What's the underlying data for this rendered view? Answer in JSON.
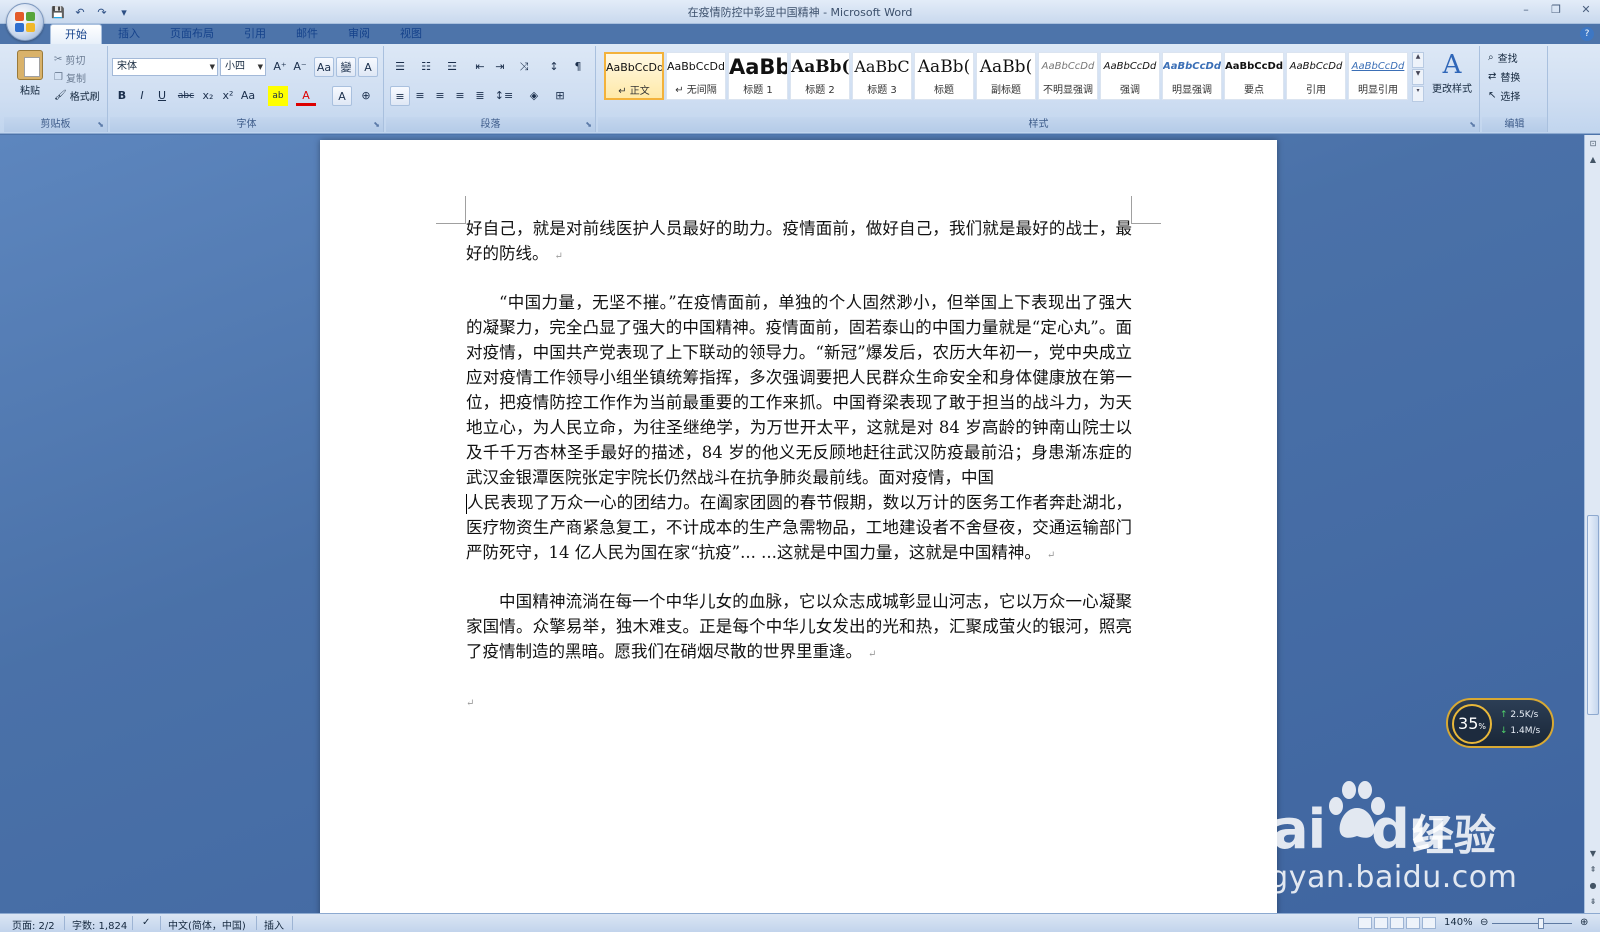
{
  "window": {
    "title": "在疫情防控中彰显中国精神 - Microsoft Word",
    "controls": [
      "–",
      "❐",
      "✕"
    ]
  },
  "qat": [
    "save-icon",
    "undo-icon",
    "redo-icon",
    "customize-icon"
  ],
  "tabs": [
    "开始",
    "插入",
    "页面布局",
    "引用",
    "邮件",
    "审阅",
    "视图"
  ],
  "ribbon": {
    "clipboard": {
      "label": "剪贴板",
      "paste": "粘贴",
      "cut": "剪切",
      "copy": "复制",
      "format_painter": "格式刷"
    },
    "font": {
      "label": "字体",
      "font_name": "宋体",
      "font_size": "小四",
      "buttons_row1": [
        "A⁺",
        "A⁻",
        "Aa",
        "變",
        "A"
      ],
      "buttons_row2": [
        "B",
        "I",
        "U",
        "abc",
        "x₂",
        "x²",
        "Aa",
        "ab",
        "A",
        "A",
        "⊕"
      ]
    },
    "paragraph": {
      "label": "段落",
      "buttons_row1": [
        "☰",
        "☷",
        "☲",
        "⇤",
        "⇥",
        "⤨",
        "↕",
        "¶"
      ],
      "buttons_row2": [
        "≡",
        "≡",
        "≡",
        "≡",
        "≣",
        "↕≡",
        "◈",
        "⊞"
      ]
    },
    "styles": {
      "label": "样式",
      "items": [
        {
          "sample": "AaBbCcDd",
          "name": "↵ 正文",
          "selected": true
        },
        {
          "sample": "AaBbCcDd",
          "name": "↵ 无间隔",
          "selected": false
        },
        {
          "sample": "AaBb",
          "name": "标题 1",
          "selected": false
        },
        {
          "sample": "AaBb(",
          "name": "标题 2",
          "selected": false
        },
        {
          "sample": "AaBbC",
          "name": "标题 3",
          "selected": false
        },
        {
          "sample": "AaBb(",
          "name": "标题",
          "selected": false
        },
        {
          "sample": "AaBb(",
          "name": "副标题",
          "selected": false
        },
        {
          "sample": "AaBbCcDd",
          "name": "不明显强调",
          "selected": false
        },
        {
          "sample": "AaBbCcDd",
          "name": "强调",
          "selected": false
        },
        {
          "sample": "AaBbCcDd",
          "name": "明显强调",
          "selected": false
        },
        {
          "sample": "AaBbCcDd",
          "name": "要点",
          "selected": false
        },
        {
          "sample": "AaBbCcDd",
          "name": "引用",
          "selected": false
        },
        {
          "sample": "AaBbCcDd",
          "name": "明显引用",
          "selected": false
        }
      ],
      "change_styles": "更改样式"
    },
    "editing": {
      "label": "编辑",
      "find": "查找",
      "replace": "替换",
      "select": "选择"
    }
  },
  "document": {
    "paragraphs": [
      {
        "text": "好自己，就是对前线医护人员最好的助力。疫情面前，做好自己，我们就是最好的战士，最好的防线。",
        "indent": false
      },
      {
        "text": "“中国力量，无坚不摧。”在疫情面前，单独的个人固然渺小，但举国上下表现出了强大的凝聚力，完全凸显了强大的中国精神。疫情面前，固若泰山的中国力量就是“定心丸”。面对疫情，中国共产党表现了上下联动的领导力。“新冠”爆发后，农历大年初一，党中央成立应对疫情工作领导小组坐镇统筹指挥，多次强调要把人民群众生命安全和身体健康放在第一位，把疫情防控工作作为当前最重要的工作来抓。中国脊梁表现了敢于担当的战斗力，为天地立心，为人民立命，为往圣继绝学，为万世开太平，这就是对 84 岁高龄的钟南山院士以及千千万杏林圣手最好的描述，84 岁的他义无反顾地赶往武汉防疫最前沿；身患渐冻症的武汉金银潭医院张定宇院长仍然战斗在抗争肺炎最前线。面对疫情，中国",
        "indent": true
      },
      {
        "text": "人民表现了万众一心的团结力。在阖家团圆的春节假期，数以万计的医务工作者奔赴湖北，医疗物资生产商紧急复工，不计成本的生产急需物品，工地建设者不舍昼夜，交通运输部门严防死守，14 亿人民为国在家“抗疫”... ...这就是中国力量，这就是中国精神。",
        "indent": false
      },
      {
        "text": "中国精神流淌在每一个中华儿女的血脉，它以众志成城彰显山河志，它以万众一心凝聚家国情。众擎易举，独木难支。正是每个中华儿女发出的光和热，汇聚成萤火的银河，照亮了疫情制造的黑暗。愿我们在硝烟尽散的世界里重逢。",
        "indent": true
      },
      {
        "text": "",
        "indent": false
      }
    ],
    "para_mark": "↵"
  },
  "network_widget": {
    "percent": "35",
    "percent_unit": "%",
    "up": "2.5K/s",
    "down": "1.4M/s"
  },
  "watermark": {
    "logo": "Bai",
    "logo2": "du",
    "jingyan": "经验",
    "url": "jingyan.baidu.com"
  },
  "status": {
    "page": "页面: 2/2",
    "words": "字数: 1,824",
    "language": "中文(简体，中国)",
    "mode": "插入",
    "zoom": "140%"
  }
}
